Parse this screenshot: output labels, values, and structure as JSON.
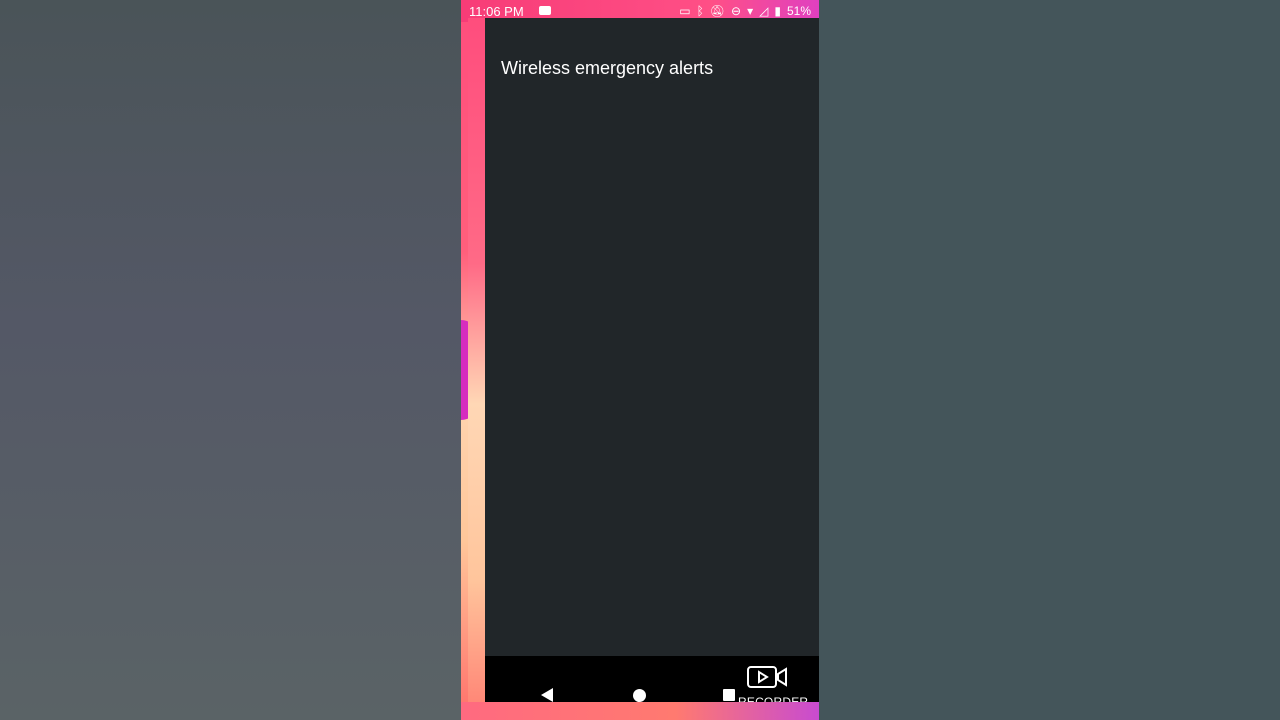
{
  "status_bar": {
    "time": "11:06 PM",
    "battery": "51%",
    "icons": [
      "video-recording-icon",
      "cast-icon",
      "bluetooth-icon",
      "notifications-off-icon",
      "do-not-disturb-icon",
      "wifi-icon",
      "no-signal-icon",
      "battery-saver-icon"
    ]
  },
  "screen": {
    "title": "Wireless emergency alerts"
  },
  "nav_bar": {
    "recorder_label": "RECORDER"
  },
  "colors": {
    "panel_bg": "#212629",
    "status_accent": "#f73c77"
  }
}
